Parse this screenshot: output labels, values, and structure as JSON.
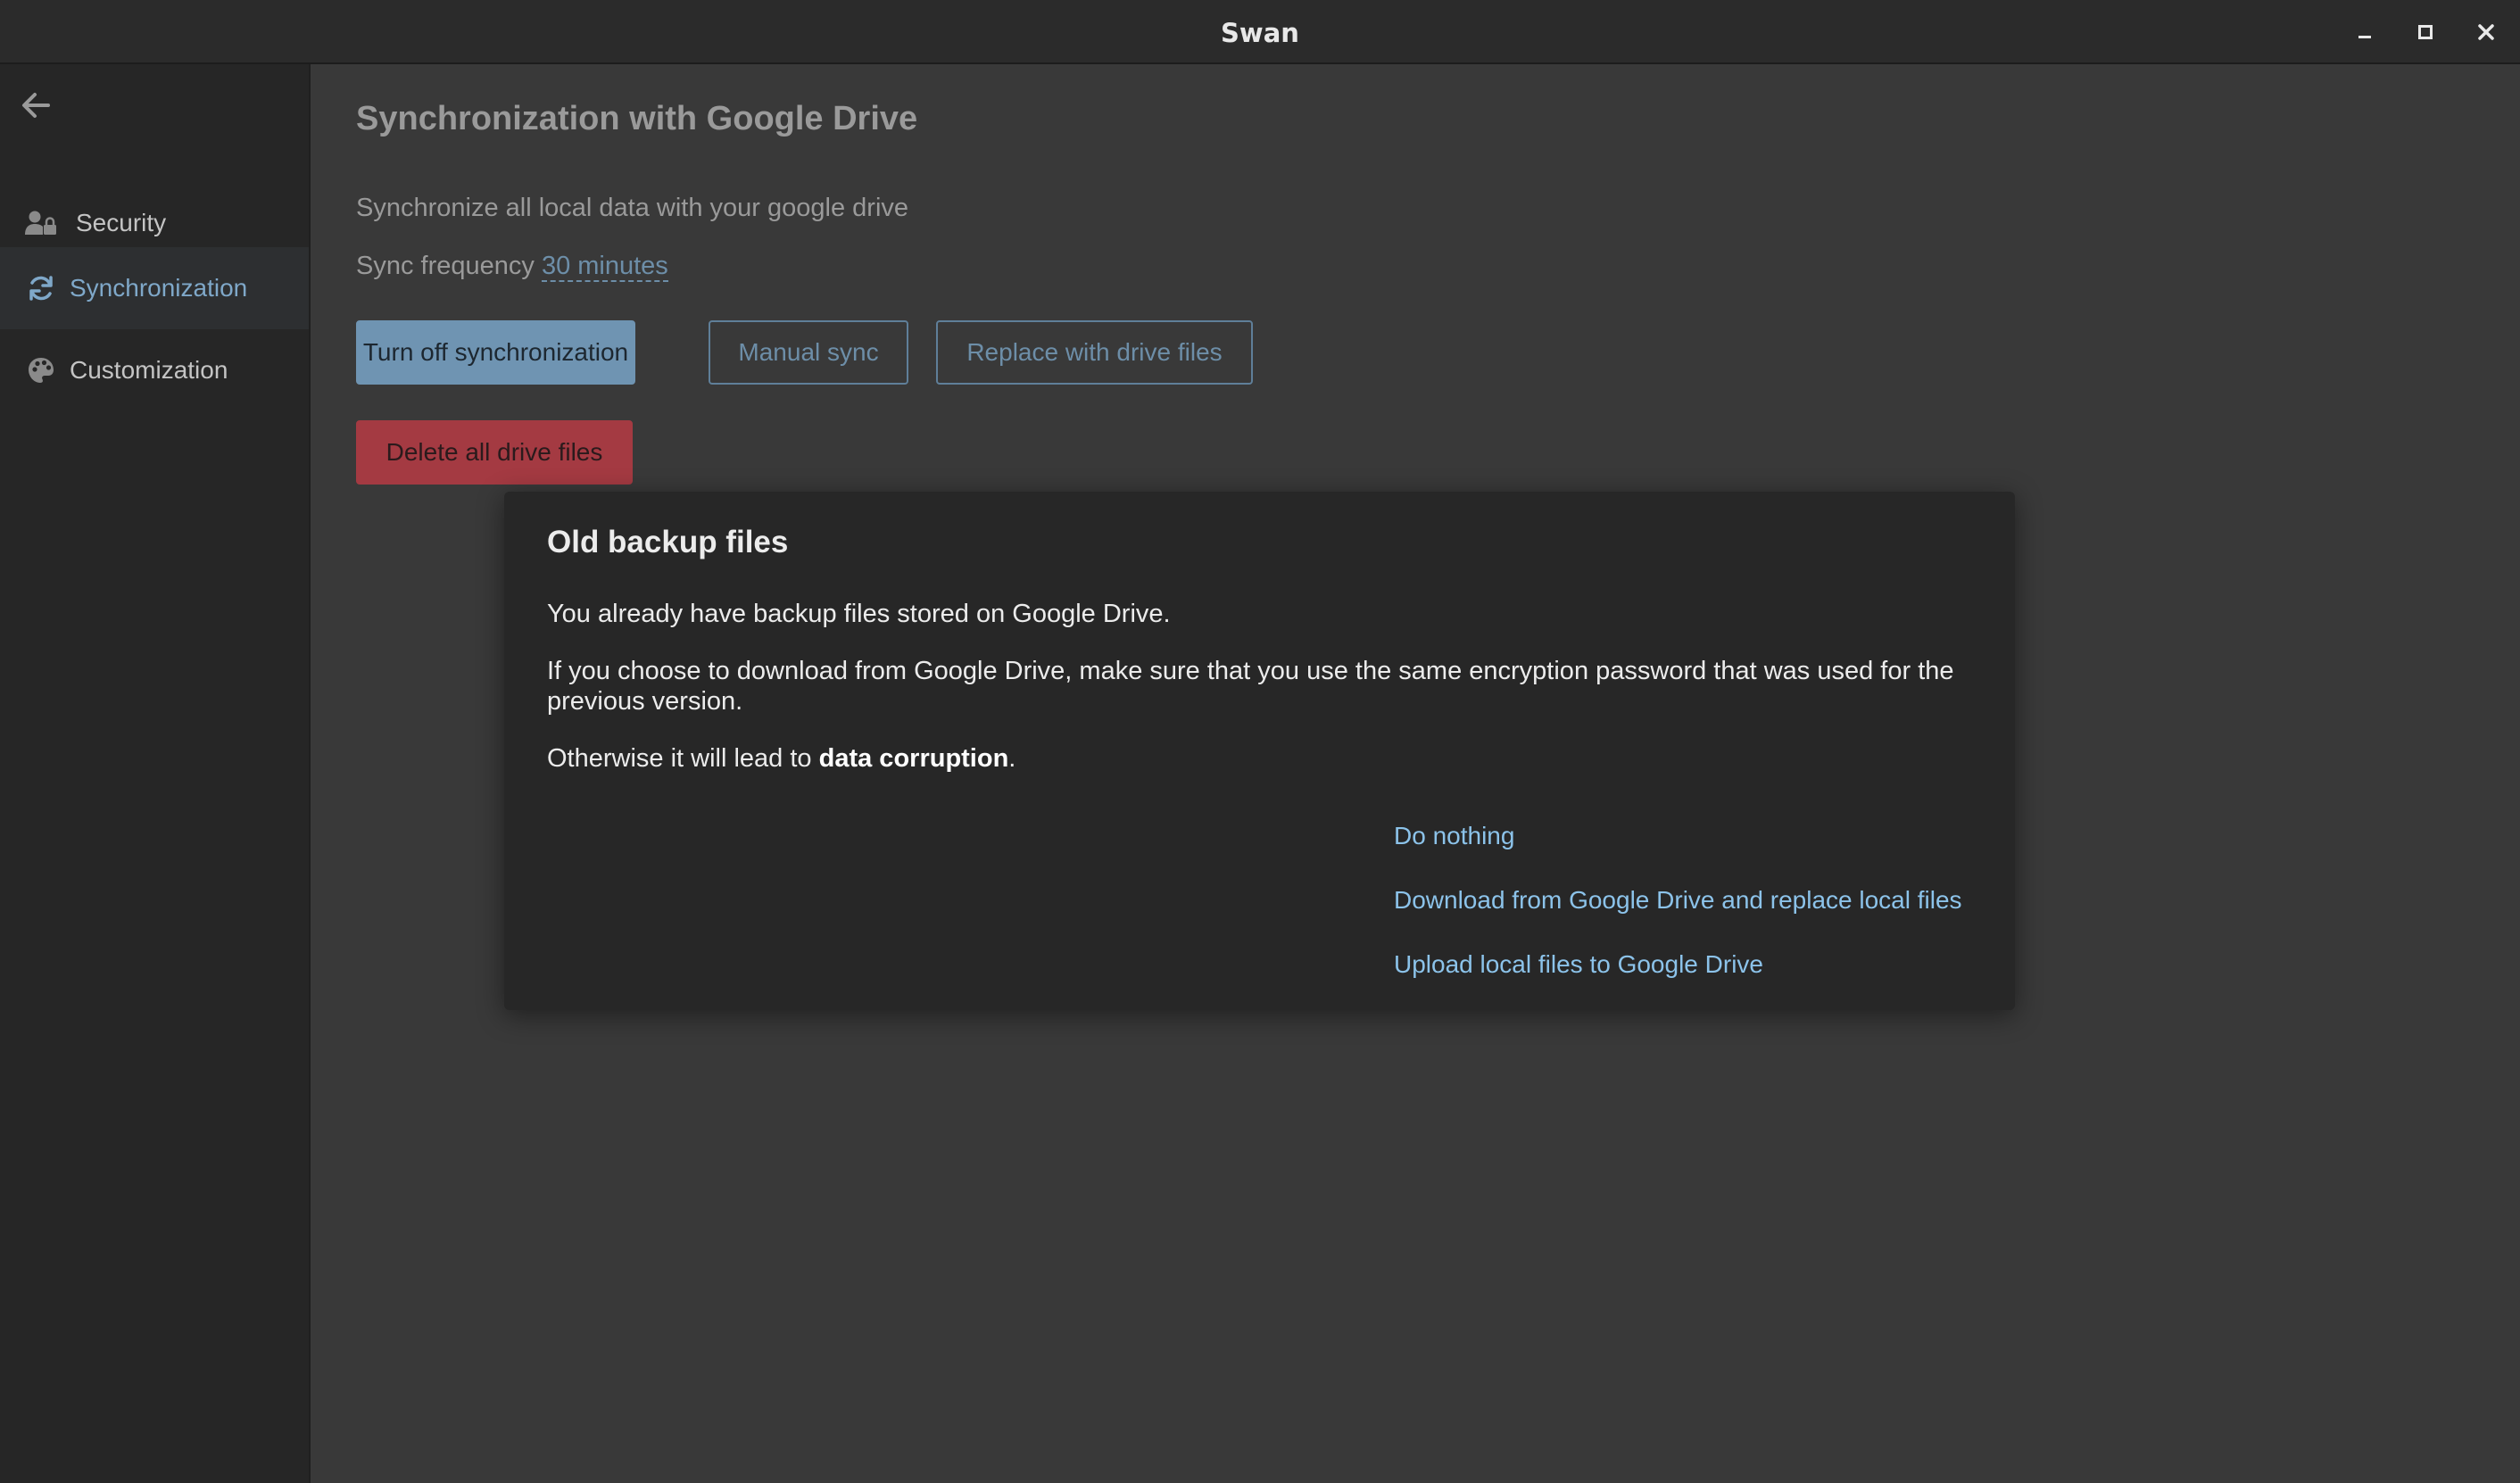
{
  "window": {
    "title": "Swan",
    "controls": [
      "minimize-icon",
      "maximize-icon",
      "close-icon"
    ]
  },
  "sidebar": {
    "back_icon": "arrow-left-icon",
    "items": [
      {
        "label": "Security",
        "icon": "user-lock-icon",
        "active": false
      },
      {
        "label": "Synchronization",
        "icon": "sync-icon",
        "active": true
      },
      {
        "label": "Customization",
        "icon": "palette-icon",
        "active": false
      }
    ]
  },
  "main": {
    "title": "Synchronization with Google Drive",
    "description": "Synchronize all local data with your google drive",
    "frequency_label": "Sync frequency",
    "frequency_value": "30 minutes",
    "buttons": {
      "turn_off": "Turn off synchronization",
      "manual_sync": "Manual sync",
      "replace": "Replace with drive files",
      "delete": "Delete all drive files"
    }
  },
  "dialog": {
    "title": "Old backup files",
    "p1": "You already have backup files stored on Google Drive.",
    "p2": "If you choose to download from Google Drive, make sure that you use the same encryption password that was used for the previous version.",
    "p3_before": "Otherwise it will lead to ",
    "p3_bold": "data corruption",
    "p3_after": ".",
    "actions": {
      "do_nothing": "Do nothing",
      "download": "Download from Google Drive and replace local files",
      "upload": "Upload local files to Google Drive"
    }
  },
  "colors": {
    "accent": "#6f94b2",
    "link": "#8cc3ea",
    "danger": "#a43a42",
    "sidebar_active_text": "#7fa8c9"
  }
}
